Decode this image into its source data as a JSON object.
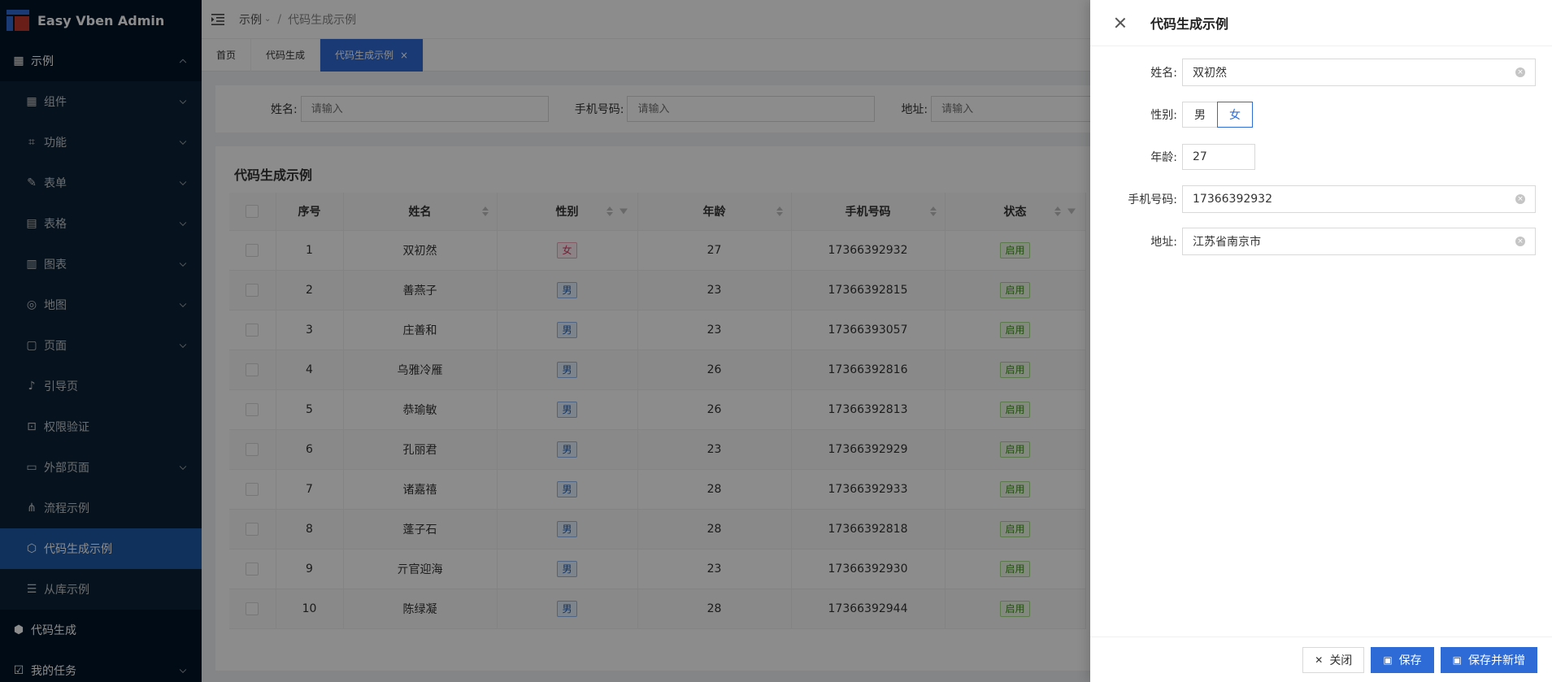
{
  "app": {
    "title": "Easy Vben Admin"
  },
  "sidebar": {
    "items": [
      {
        "label": "示例",
        "level": 1,
        "icon": "grid-icon",
        "expanded": true
      },
      {
        "label": "组件",
        "level": 2,
        "icon": "grid-icon"
      },
      {
        "label": "功能",
        "level": 2,
        "icon": "scan-icon"
      },
      {
        "label": "表单",
        "level": 2,
        "icon": "edit-icon"
      },
      {
        "label": "表格",
        "level": 2,
        "icon": "table-icon"
      },
      {
        "label": "图表",
        "level": 2,
        "icon": "chart-icon"
      },
      {
        "label": "地图",
        "level": 2,
        "icon": "location-icon"
      },
      {
        "label": "页面",
        "level": 2,
        "icon": "page-icon"
      },
      {
        "label": "引导页",
        "level": 2,
        "icon": "bell-icon"
      },
      {
        "label": "权限验证",
        "level": 2,
        "icon": "lock-icon"
      },
      {
        "label": "外部页面",
        "level": 2,
        "icon": "monitor-icon"
      },
      {
        "label": "流程示例",
        "level": 2,
        "icon": "flow-icon"
      },
      {
        "label": "代码生成示例",
        "level": 2,
        "icon": "cube-icon",
        "active": true
      },
      {
        "label": "从库示例",
        "level": 2,
        "icon": "list-icon"
      },
      {
        "label": "代码生成",
        "level": 1,
        "icon": "code-icon"
      },
      {
        "label": "我的任务",
        "level": 1,
        "icon": "task-icon"
      }
    ]
  },
  "header": {
    "breadcrumb": {
      "root": "示例",
      "sep": "/",
      "current": "代码生成示例"
    }
  },
  "tabs": [
    {
      "label": "首页"
    },
    {
      "label": "代码生成"
    },
    {
      "label": "代码生成示例",
      "active": true,
      "close": "×"
    }
  ],
  "search": {
    "fields": [
      {
        "label": "姓名:",
        "placeholder": "请输入"
      },
      {
        "label": "手机号码:",
        "placeholder": "请输入"
      },
      {
        "label": "地址:",
        "placeholder": "请输入"
      }
    ]
  },
  "table": {
    "title": "代码生成示例",
    "columns": [
      "序号",
      "姓名",
      "性别",
      "年龄",
      "手机号码",
      "状态"
    ],
    "rows": [
      {
        "no": "1",
        "name": "双初然",
        "gender": "女",
        "age": "27",
        "phone": "17366392932",
        "status": "启用"
      },
      {
        "no": "2",
        "name": "善燕子",
        "gender": "男",
        "age": "23",
        "phone": "17366392815",
        "status": "启用"
      },
      {
        "no": "3",
        "name": "庄善和",
        "gender": "男",
        "age": "23",
        "phone": "17366393057",
        "status": "启用"
      },
      {
        "no": "4",
        "name": "乌雅冷雁",
        "gender": "男",
        "age": "26",
        "phone": "17366392816",
        "status": "启用"
      },
      {
        "no": "5",
        "name": "恭瑜敏",
        "gender": "男",
        "age": "26",
        "phone": "17366392813",
        "status": "启用"
      },
      {
        "no": "6",
        "name": "孔丽君",
        "gender": "男",
        "age": "23",
        "phone": "17366392929",
        "status": "启用"
      },
      {
        "no": "7",
        "name": "诸嘉禧",
        "gender": "男",
        "age": "28",
        "phone": "17366392933",
        "status": "启用"
      },
      {
        "no": "8",
        "name": "蓬子石",
        "gender": "男",
        "age": "28",
        "phone": "17366392818",
        "status": "启用"
      },
      {
        "no": "9",
        "name": "亓官迎海",
        "gender": "男",
        "age": "23",
        "phone": "17366392930",
        "status": "启用"
      },
      {
        "no": "10",
        "name": "陈绿凝",
        "gender": "男",
        "age": "28",
        "phone": "17366392944",
        "status": "启用"
      }
    ]
  },
  "drawer": {
    "title": "代码生成示例",
    "fields": {
      "name": {
        "label": "姓名:",
        "value": "双初然"
      },
      "gender": {
        "label": "性别:",
        "options": [
          "男",
          "女"
        ],
        "selected": "女"
      },
      "age": {
        "label": "年龄:",
        "value": "27"
      },
      "phone": {
        "label": "手机号码:",
        "value": "17366392932"
      },
      "address": {
        "label": "地址:",
        "value": "江苏省南京市"
      }
    },
    "buttons": {
      "close": "关闭",
      "save": "保存",
      "save_new": "保存并新增"
    }
  },
  "colors": {
    "sidebar_bg": "#001529",
    "primary": "#2f6bd6",
    "active_menu": "#1e5aa8"
  }
}
